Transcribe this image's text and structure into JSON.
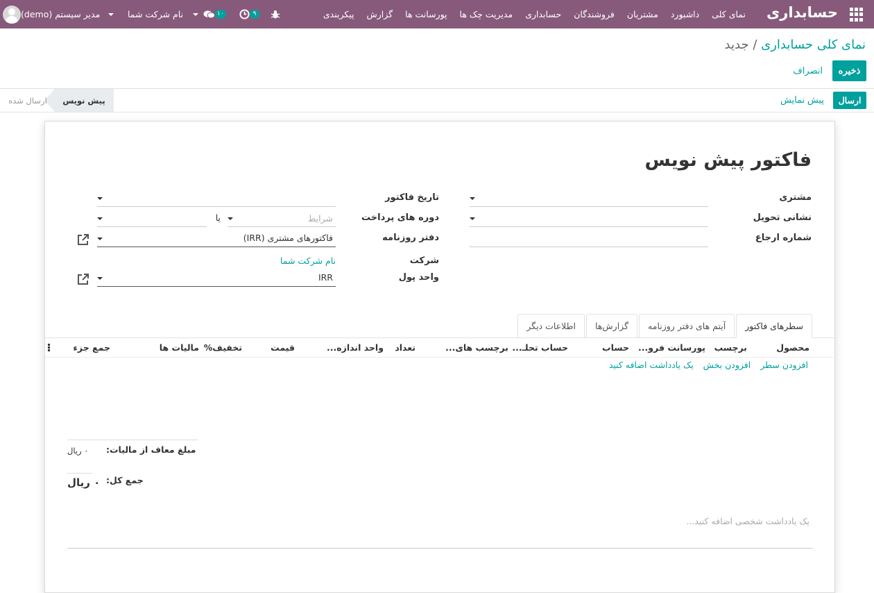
{
  "navbar": {
    "brand": "حسابداری",
    "menu": [
      {
        "label": "نمای کلی"
      },
      {
        "label": "داشبورد"
      },
      {
        "label": "مشتریان"
      },
      {
        "label": "فروشندگان"
      },
      {
        "label": "حسابداری"
      },
      {
        "label": "مدیریت چک ها"
      },
      {
        "label": "پورسانت ها"
      },
      {
        "label": "گزارش"
      },
      {
        "label": "پیکربندی"
      }
    ],
    "activity_count": "۹",
    "messages_count": "۱۰",
    "company": "نام شرکت شما",
    "user": "مدیر سیستم (demo)",
    "color": "#875a7b"
  },
  "control": {
    "breadcrumb_parent": "نمای کلی حسابداری",
    "breadcrumb_sep": "/",
    "breadcrumb_current": "جدید",
    "save_label": "ذخیره",
    "discard_label": "انصراف"
  },
  "statusbar": {
    "send_label": "ارسال",
    "preview_label": "پیش نمایش",
    "stages": [
      {
        "label": "پیش نویس",
        "active": true
      },
      {
        "label": "ارسال شده",
        "active": false
      }
    ]
  },
  "form": {
    "title": "فاکتور پیش نویس",
    "labels": {
      "customer": "مشتری",
      "delivery_address": "نشانی تحویل",
      "reference": "شماره ارجاع",
      "invoice_date": "تاریخ فاکتور",
      "payment_terms": "دوره های پرداخت",
      "journal": "دفتر روزنامه",
      "company": "شرکت",
      "currency": "واحد پول"
    },
    "terms_placeholder": "شرایط",
    "or_label": "یا",
    "journal_value": "فاکتورهای مشتری (IRR)",
    "company_value": "نام شرکت شما",
    "currency_value": "IRR"
  },
  "tabs": [
    {
      "label": "سطرهای فاکتور",
      "active": true
    },
    {
      "label": "آیتم های دفتر روزنامه",
      "active": false
    },
    {
      "label": "گزارش‌ها",
      "active": false
    },
    {
      "label": "اطلاعات دیگر",
      "active": false
    }
  ],
  "lines_table": {
    "columns": [
      "محصول",
      "برچسب",
      "پورسانت فرو...",
      "حساب",
      "حساب تحلـ...",
      "برچسب های...",
      "تعداد",
      "واحد اندازه...",
      "قیمت",
      "تخفیف%",
      "مالیات ها",
      "جمع جزء"
    ],
    "add_line": "افزودن سطر",
    "add_section": "افزودن بخش",
    "add_note": "یک یادداشت اضافه کنید"
  },
  "totals": {
    "untaxed_label": "مبلغ معاف از مالیات:",
    "untaxed_value": "۰ ریال",
    "total_label": "جمع کل:",
    "total_value": "۰ ریال"
  },
  "narration_placeholder": "یک یادداشت شخصی اضافه کنید...",
  "accent": "#00a09d"
}
